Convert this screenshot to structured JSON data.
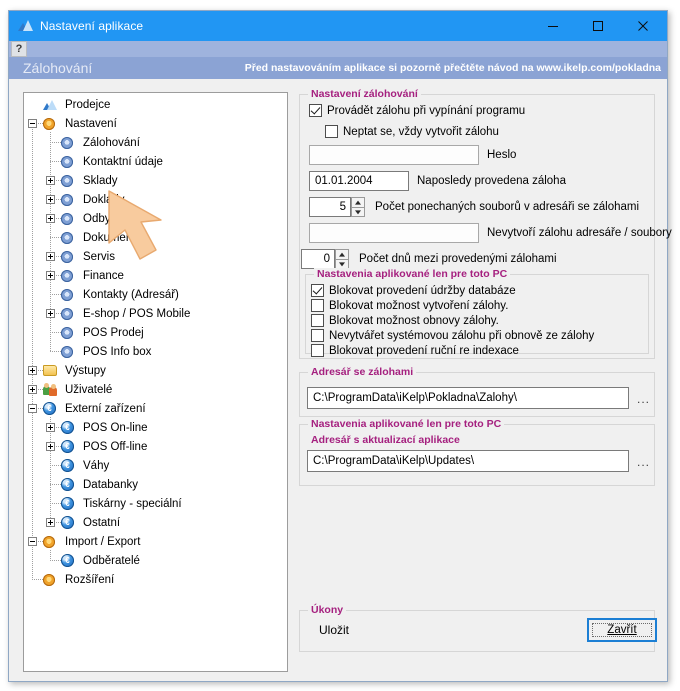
{
  "window": {
    "title": "Nastavení aplikace",
    "app_icon": "app-logo-icon",
    "controls": {
      "minimize": "minimize-icon",
      "maximize": "maximize-icon",
      "close": "close-icon"
    },
    "accent_color": "#2196f3"
  },
  "toolbar": {
    "help_label": "?"
  },
  "banner": {
    "title": "Zálohování",
    "note": "Před nastavováním aplikace si pozorně přečtěte návod na www.ikelp.com/pokladna",
    "bg_color": "#8ba3d4"
  },
  "tree": {
    "items": [
      {
        "label": "Prodejce",
        "depth": 0,
        "icon": "app-logo-icon",
        "expander": "none"
      },
      {
        "label": "Nastavení",
        "depth": 0,
        "icon": "gear-orange-icon",
        "expander": "minus"
      },
      {
        "label": "Zálohování",
        "depth": 1,
        "icon": "gear-blue-icon",
        "expander": "none"
      },
      {
        "label": "Kontaktní údaje",
        "depth": 1,
        "icon": "gear-blue-icon",
        "expander": "none"
      },
      {
        "label": "Sklady",
        "depth": 1,
        "icon": "gear-blue-icon",
        "expander": "plus"
      },
      {
        "label": "Doklady",
        "depth": 1,
        "icon": "gear-blue-icon",
        "expander": "plus"
      },
      {
        "label": "Odbyt",
        "depth": 1,
        "icon": "gear-blue-icon",
        "expander": "plus"
      },
      {
        "label": "Dokumenty",
        "depth": 1,
        "icon": "gear-blue-icon",
        "expander": "none"
      },
      {
        "label": "Servis",
        "depth": 1,
        "icon": "gear-blue-icon",
        "expander": "plus"
      },
      {
        "label": "Finance",
        "depth": 1,
        "icon": "gear-blue-icon",
        "expander": "plus"
      },
      {
        "label": "Kontakty (Adresář)",
        "depth": 1,
        "icon": "gear-blue-icon",
        "expander": "none"
      },
      {
        "label": "E-shop / POS Mobile",
        "depth": 1,
        "icon": "gear-blue-icon",
        "expander": "plus"
      },
      {
        "label": "POS Prodej",
        "depth": 1,
        "icon": "gear-blue-icon",
        "expander": "none"
      },
      {
        "label": "POS Info box",
        "depth": 1,
        "icon": "gear-blue-icon",
        "expander": "none"
      },
      {
        "label": "Výstupy",
        "depth": 0,
        "icon": "folder-icon",
        "expander": "plus"
      },
      {
        "label": "Uživatelé",
        "depth": 0,
        "icon": "users-icon",
        "expander": "plus"
      },
      {
        "label": "Externí zařízení",
        "depth": 0,
        "icon": "euro-icon",
        "expander": "minus"
      },
      {
        "label": "POS On-line",
        "depth": 1,
        "icon": "euro-icon",
        "expander": "plus"
      },
      {
        "label": "POS Off-line",
        "depth": 1,
        "icon": "euro-icon",
        "expander": "plus"
      },
      {
        "label": "Váhy",
        "depth": 1,
        "icon": "euro-icon",
        "expander": "none"
      },
      {
        "label": "Databanky",
        "depth": 1,
        "icon": "euro-icon",
        "expander": "none"
      },
      {
        "label": "Tiskárny - speciální",
        "depth": 1,
        "icon": "euro-icon",
        "expander": "none"
      },
      {
        "label": "Ostatní",
        "depth": 1,
        "icon": "euro-icon",
        "expander": "plus"
      },
      {
        "label": "Import / Export",
        "depth": 0,
        "icon": "gear-orange-icon",
        "expander": "minus"
      },
      {
        "label": "Odběratelé",
        "depth": 1,
        "icon": "euro-icon",
        "expander": "none"
      },
      {
        "label": "Rozšíření",
        "depth": 0,
        "icon": "gear-orange-icon",
        "expander": "none"
      }
    ]
  },
  "backup_group": {
    "legend": "Nastavení zálohování",
    "perform_on_exit": {
      "label": "Provádět zálohu při vypínání programu",
      "checked": true
    },
    "dont_ask": {
      "label": "Neptat se, vždy vytvořit zálohu",
      "checked": false
    },
    "password": {
      "value": "",
      "label": "Heslo"
    },
    "last_backup": {
      "value": "01.01.2004",
      "label": "Naposledy provedena záloha"
    },
    "kept_files": {
      "value": "5",
      "label": "Počet ponechaných souborů v adresáři se zálohami"
    },
    "exclude": {
      "value": "",
      "label": "Nevytvoří zálohu adresáře / soubory"
    },
    "days_between": {
      "value": "0",
      "label": "Počet dnů mezi provedenými zálohami"
    }
  },
  "pc_group": {
    "legend": "Nastavenia aplikované len pre toto PC",
    "options": [
      {
        "label": "Blokovat provedení údržby databáze",
        "checked": true
      },
      {
        "label": "Blokovat možnost vytvoření zálohy.",
        "checked": false
      },
      {
        "label": "Blokovat možnost obnovy zálohy.",
        "checked": false
      },
      {
        "label": "Nevytvářet systémovou zálohu při obnově ze zálohy",
        "checked": false
      },
      {
        "label": "Blokovat provedení ruční re indexace",
        "checked": false
      }
    ]
  },
  "backup_dir_group": {
    "legend": "Adresář se zálohami",
    "path": "C:\\ProgramData\\iKelp\\Pokladna\\Zalohy\\",
    "browse_label": "..."
  },
  "update_dir_group": {
    "legend": "Nastavenia aplikované len pre toto PC",
    "field_label": "Adresář s aktualizací aplikace",
    "path": "C:\\ProgramData\\iKelp\\Updates\\",
    "browse_label": "..."
  },
  "actions_group": {
    "legend": "Úkony",
    "save_label": "Uložit",
    "close_label_prefix": "",
    "close_accel": "Z",
    "close_label_rest": "avřít",
    "close_label": "Zavřít"
  },
  "cursor": {
    "icon": "arrow-cursor-icon",
    "fill": "#f7c89a"
  }
}
